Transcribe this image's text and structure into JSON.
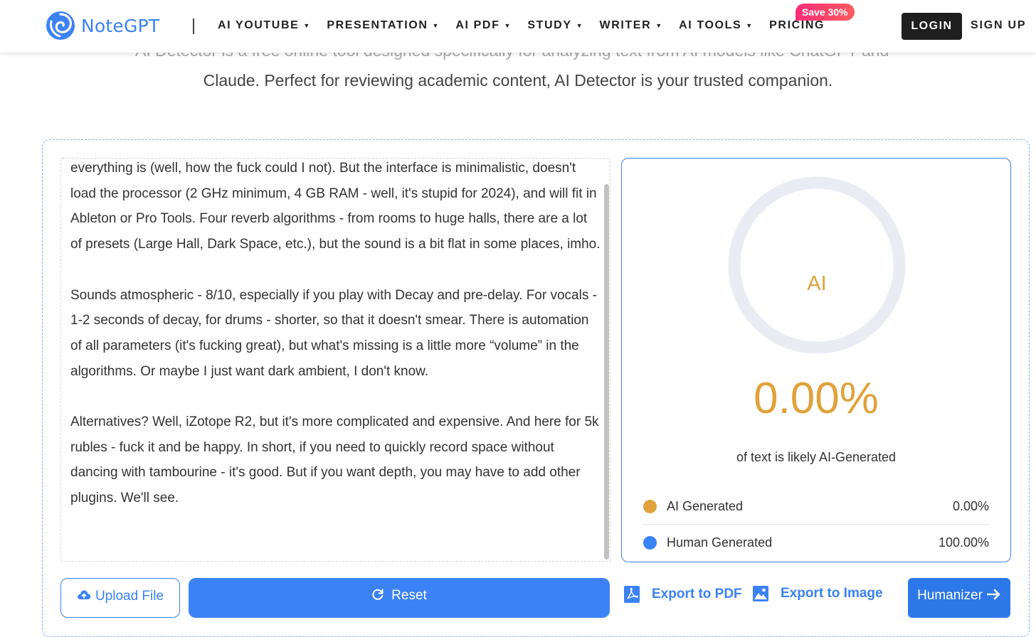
{
  "header": {
    "brand": "NoteGPT",
    "nav": [
      {
        "label": "AI YOUTUBE",
        "has_dropdown": true
      },
      {
        "label": "PRESENTATION",
        "has_dropdown": true
      },
      {
        "label": "AI PDF",
        "has_dropdown": true
      },
      {
        "label": "STUDY",
        "has_dropdown": true
      },
      {
        "label": "WRITER",
        "has_dropdown": true
      },
      {
        "label": "AI TOOLS",
        "has_dropdown": true
      },
      {
        "label": "PRICING",
        "has_dropdown": false
      }
    ],
    "save_badge": "Save  30%",
    "login": "LOGIN",
    "signup": "SIGN UP"
  },
  "intro": {
    "line1_partial": "AI Detector is a free online tool designed specifically for analyzing text from AI models like ChatGPT and",
    "line2": "Claude. Perfect for reviewing academic content, AI Detector is your trusted companion."
  },
  "input_text": {
    "paragraphs": [
      "everything is (well, how the fuck could I not). But the interface is minimalistic, doesn't load the processor (2 GHz minimum, 4 GB RAM - well, it's stupid for 2024), and will fit in Ableton or Pro Tools. Four reverb algorithms - from rooms to huge halls, there are a lot of presets (Large Hall, Dark Space, etc.), but the sound is a bit flat in some places, imho.",
      "Sounds atmospheric - 8/10, especially if you play with Decay and pre-delay. For vocals - 1-2 seconds of decay, for drums - shorter, so that it doesn't smear. There is automation of all parameters (it's fucking great), but what's missing is a little more “volume” in the algorithms. Or maybe I just want dark ambient, I don't know.",
      "Alternatives? Well, iZotope R2, but it's more complicated and expensive. And here for 5k rubles - fuck it and be happy. In short, if you need to quickly record space without dancing with tambourine - it's good. But if you want depth, you may have to add other plugins. We'll see."
    ]
  },
  "result": {
    "ring_label": "AI",
    "ai_fraction": 0.0,
    "percent_text": "0.00%",
    "caption": "of text is likely AI-Generated",
    "legend": [
      {
        "label": "AI Generated",
        "value": "0.00%",
        "color": "#e0a23a"
      },
      {
        "label": "Human Generated",
        "value": "100.00%",
        "color": "#3b82f6"
      }
    ]
  },
  "actions": {
    "upload": "Upload File",
    "reset": "Reset",
    "export_pdf": "Export to PDF",
    "export_image": "Export to Image",
    "humanizer": "Humanizer"
  },
  "colors": {
    "accent": "#3b82f6",
    "ai": "#e0a23a",
    "ring_track": "#e9edf3",
    "badge": "#ff2d7a"
  }
}
